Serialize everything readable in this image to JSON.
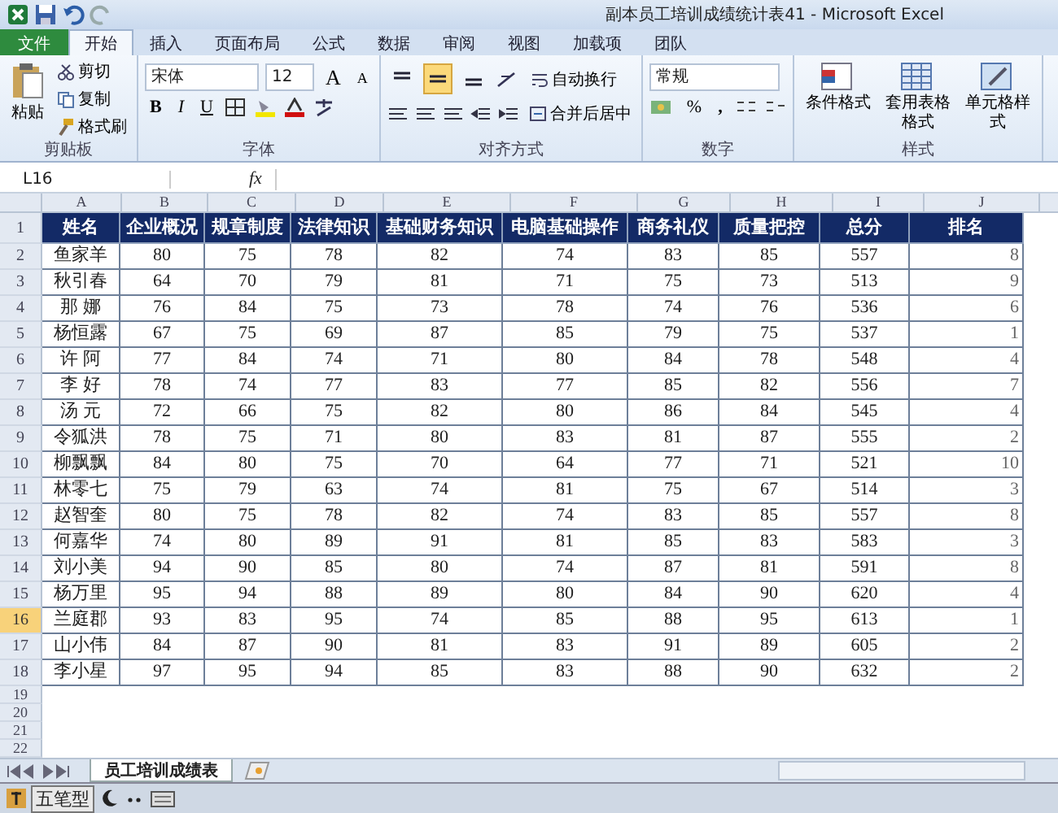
{
  "title_bar": {
    "title": "副本员工培训成绩统计表41  -  Microsoft Excel"
  },
  "ribbon_tabs": [
    {
      "label": "文件",
      "kind": "file",
      "selected": false
    },
    {
      "label": "开始",
      "kind": "tab",
      "selected": true
    },
    {
      "label": "插入",
      "kind": "tab",
      "selected": false
    },
    {
      "label": "页面布局",
      "kind": "tab",
      "selected": false
    },
    {
      "label": "公式",
      "kind": "tab",
      "selected": false
    },
    {
      "label": "数据",
      "kind": "tab",
      "selected": false
    },
    {
      "label": "审阅",
      "kind": "tab",
      "selected": false
    },
    {
      "label": "视图",
      "kind": "tab",
      "selected": false
    },
    {
      "label": "加载项",
      "kind": "tab",
      "selected": false
    },
    {
      "label": "团队",
      "kind": "tab",
      "selected": false
    }
  ],
  "ribbon": {
    "clipboard": {
      "paste": "粘贴",
      "cut": "剪切",
      "copy": "复制",
      "format_painter": "格式刷",
      "label": "剪贴板"
    },
    "font": {
      "font_name": "宋体",
      "font_size": "12",
      "grow_font": "A",
      "shrink_font": "A",
      "bold": "B",
      "italic": "I",
      "underline": "U",
      "label": "字体"
    },
    "alignment": {
      "vertical_align": [
        {
          "selected": false
        },
        {
          "selected": true
        },
        {
          "selected": false
        }
      ],
      "wrap_text": "自动换行",
      "merge_center": "合并后居中",
      "label": "对齐方式"
    },
    "number": {
      "format": "常规",
      "percent": "%",
      "comma": ",",
      "label": "数字"
    },
    "styles": {
      "conditional": "条件格式",
      "table_format": "套用表格格式",
      "cell_styles": "单元格样式",
      "label": "样式"
    }
  },
  "formula_bar": {
    "name_box": "L16",
    "fx": "fx"
  },
  "sheet": {
    "columns": [
      {
        "letter": "A",
        "selected": false
      },
      {
        "letter": "B",
        "selected": false
      },
      {
        "letter": "C",
        "selected": false
      },
      {
        "letter": "D",
        "selected": false
      },
      {
        "letter": "E",
        "selected": false
      },
      {
        "letter": "F",
        "selected": false
      },
      {
        "letter": "G",
        "selected": false
      },
      {
        "letter": "H",
        "selected": false
      },
      {
        "letter": "I",
        "selected": false
      },
      {
        "letter": "J",
        "selected": false
      }
    ],
    "rows": [
      {
        "number": "1",
        "kind": "header",
        "selected": false,
        "cells": [
          "姓名",
          "企业概况",
          "规章制度",
          "法律知识",
          "基础财务知识",
          "电脑基础操作",
          "商务礼仪",
          "质量把控",
          "总分",
          "排名"
        ]
      },
      {
        "number": "2",
        "kind": "data",
        "selected": false,
        "cells": [
          "鱼家羊",
          "80",
          "75",
          "78",
          "82",
          "74",
          "83",
          "85",
          "557",
          "8"
        ]
      },
      {
        "number": "3",
        "kind": "data",
        "selected": false,
        "cells": [
          "秋引春",
          "64",
          "70",
          "79",
          "81",
          "71",
          "75",
          "73",
          "513",
          "9"
        ]
      },
      {
        "number": "4",
        "kind": "data",
        "selected": false,
        "cells": [
          "那 娜",
          "76",
          "84",
          "75",
          "73",
          "78",
          "74",
          "76",
          "536",
          "6"
        ]
      },
      {
        "number": "5",
        "kind": "data",
        "selected": false,
        "cells": [
          "杨恒露",
          "67",
          "75",
          "69",
          "87",
          "85",
          "79",
          "75",
          "537",
          "1"
        ]
      },
      {
        "number": "6",
        "kind": "data",
        "selected": false,
        "cells": [
          "许 阿",
          "77",
          "84",
          "74",
          "71",
          "80",
          "84",
          "78",
          "548",
          "4"
        ]
      },
      {
        "number": "7",
        "kind": "data",
        "selected": false,
        "cells": [
          "李 好",
          "78",
          "74",
          "77",
          "83",
          "77",
          "85",
          "82",
          "556",
          "7"
        ]
      },
      {
        "number": "8",
        "kind": "data",
        "selected": false,
        "cells": [
          "汤 元",
          "72",
          "66",
          "75",
          "82",
          "80",
          "86",
          "84",
          "545",
          "4"
        ]
      },
      {
        "number": "9",
        "kind": "data",
        "selected": false,
        "cells": [
          "令狐洪",
          "78",
          "75",
          "71",
          "80",
          "83",
          "81",
          "87",
          "555",
          "2"
        ]
      },
      {
        "number": "10",
        "kind": "data",
        "selected": false,
        "cells": [
          "柳飘飘",
          "84",
          "80",
          "75",
          "70",
          "64",
          "77",
          "71",
          "521",
          "10"
        ]
      },
      {
        "number": "11",
        "kind": "data",
        "selected": false,
        "cells": [
          "林零七",
          "75",
          "79",
          "63",
          "74",
          "81",
          "75",
          "67",
          "514",
          "3"
        ]
      },
      {
        "number": "12",
        "kind": "data",
        "selected": false,
        "cells": [
          "赵智奎",
          "80",
          "75",
          "78",
          "82",
          "74",
          "83",
          "85",
          "557",
          "8"
        ]
      },
      {
        "number": "13",
        "kind": "data",
        "selected": false,
        "cells": [
          "何嘉华",
          "74",
          "80",
          "89",
          "91",
          "81",
          "85",
          "83",
          "583",
          "3"
        ]
      },
      {
        "number": "14",
        "kind": "data",
        "selected": false,
        "cells": [
          "刘小美",
          "94",
          "90",
          "85",
          "80",
          "74",
          "87",
          "81",
          "591",
          "8"
        ]
      },
      {
        "number": "15",
        "kind": "data",
        "selected": false,
        "cells": [
          "杨万里",
          "95",
          "94",
          "88",
          "89",
          "80",
          "84",
          "90",
          "620",
          "4"
        ]
      },
      {
        "number": "16",
        "kind": "data",
        "selected": true,
        "cells": [
          "兰庭郡",
          "93",
          "83",
          "95",
          "74",
          "85",
          "88",
          "95",
          "613",
          "1"
        ]
      },
      {
        "number": "17",
        "kind": "data",
        "selected": false,
        "cells": [
          "山小伟",
          "84",
          "87",
          "90",
          "81",
          "83",
          "91",
          "89",
          "605",
          "2"
        ]
      },
      {
        "number": "18",
        "kind": "data",
        "selected": false,
        "cells": [
          "李小星",
          "97",
          "95",
          "94",
          "85",
          "83",
          "88",
          "90",
          "632",
          "2"
        ]
      },
      {
        "number": "19",
        "kind": "empty",
        "selected": false
      },
      {
        "number": "20",
        "kind": "empty",
        "selected": false
      },
      {
        "number": "21",
        "kind": "empty",
        "selected": false
      },
      {
        "number": "22",
        "kind": "empty",
        "selected": false
      }
    ]
  },
  "sheet_tabs": [
    {
      "label": "员工培训成绩表",
      "selected": true
    }
  ],
  "taskbar": {
    "ime_mode": "五笔型"
  }
}
